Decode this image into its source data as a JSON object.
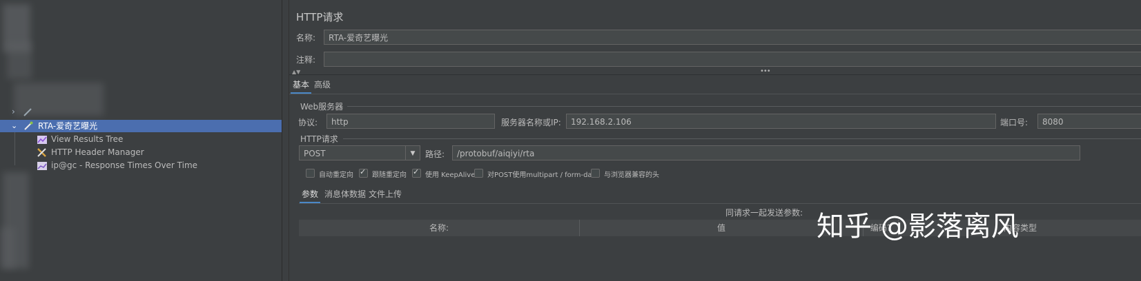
{
  "tree": {
    "selected_label": "RTA-爱奇艺曝光",
    "children": [
      {
        "label": "View Results Tree",
        "icon": "view-results-tree-icon"
      },
      {
        "label": "HTTP Header Manager",
        "icon": "header-manager-icon"
      },
      {
        "label": "ip@gc - Response Times Over Time",
        "icon": "graph-icon"
      }
    ],
    "selection_color": "#4b6eaf"
  },
  "panel": {
    "title": "HTTP请求",
    "name_label": "名称:",
    "name_value": "RTA-爱奇艺曝光",
    "comment_label": "注释:",
    "comment_value": "",
    "main_tabs": [
      "基本",
      "高级"
    ],
    "web_server": {
      "section_label": "Web服务器",
      "protocol_label": "协议:",
      "protocol_value": "http",
      "server_label": "服务器名称或IP:",
      "server_value": "192.168.2.106",
      "port_label": "端口号:",
      "port_value": "8080"
    },
    "http_request": {
      "section_label": "HTTP请求",
      "method": "POST",
      "path_label": "路径:",
      "path_value": "/protobuf/aiqiyi/rta"
    },
    "options": [
      {
        "label": "自动重定向",
        "checked": false
      },
      {
        "label": "跟随重定向",
        "checked": true
      },
      {
        "label": "使用 KeepAlive",
        "checked": true
      },
      {
        "label": "对POST使用multipart / form-data",
        "checked": false
      },
      {
        "label": "与浏览器兼容的头",
        "checked": false
      }
    ],
    "param_tabs": [
      "参数",
      "消息体数据",
      "文件上传"
    ],
    "send_params_label": "同请求一起发送参数:",
    "columns": [
      "名称:",
      "值",
      "编码?",
      "内容类型"
    ]
  },
  "watermark": "知乎 @影落离风",
  "accent_color": "#4a88c7"
}
